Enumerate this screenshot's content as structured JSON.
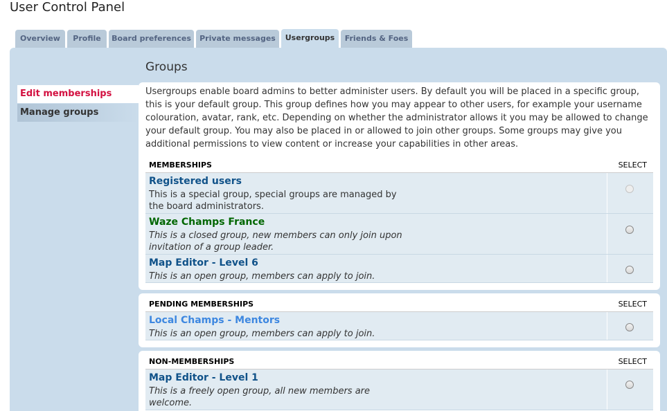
{
  "page": {
    "title": "User Control Panel"
  },
  "tabs": [
    {
      "label": "Overview",
      "active": false
    },
    {
      "label": "Profile",
      "active": false
    },
    {
      "label": "Board preferences",
      "active": false
    },
    {
      "label": "Private messages",
      "active": false
    },
    {
      "label": "Usergroups",
      "active": true
    },
    {
      "label": "Friends & Foes",
      "active": false
    }
  ],
  "sidebar": {
    "items": [
      {
        "label": "Edit memberships",
        "active": true
      },
      {
        "label": "Manage groups",
        "active": false
      }
    ]
  },
  "main": {
    "title": "Groups",
    "intro": "Usergroups enable board admins to better administer users. By default you will be placed in a specific group, this is your default group. This group defines how you may appear to other users, for example your username colouration, avatar, rank, etc. Depending on whether the administrator allows it you may be allowed to change your default group. You may also be placed in or allowed to join other groups. Some groups may give you additional permissions to view content or increase your capabilities in other areas.",
    "memberships": {
      "header": "Memberships",
      "select": "Select",
      "groups": [
        {
          "name": "Registered users",
          "desc": "This is a special group, special groups are managed by the board administrators.",
          "color": "#105289",
          "selectable": false
        },
        {
          "name": "Waze Champs France",
          "desc": "This is a closed group, new members can only join upon invitation of a group leader.",
          "color": "#006600",
          "selectable": true
        },
        {
          "name": "Map Editor - Level 6",
          "desc": "This is an open group, members can apply to join.",
          "color": "#105289",
          "selectable": true
        }
      ]
    },
    "pending": {
      "header": "Pending memberships",
      "select": "Select",
      "groups": [
        {
          "name": "Local Champs - Mentors",
          "desc": "This is an open group, members can apply to join.",
          "color": "#3d87e0",
          "selectable": true
        }
      ]
    },
    "non_memberships": {
      "header": "Non-memberships",
      "select": "Select",
      "groups": [
        {
          "name": "Map Editor - Level 1",
          "desc": "This is a freely open group, all new members are welcome.",
          "color": "#105289",
          "selectable": true
        }
      ]
    }
  },
  "colors": {
    "panel_bg": "#cadceb",
    "row_bg": "#e1ebf2",
    "tab_bg": "#b9cad9",
    "active_link": "#d31141"
  }
}
